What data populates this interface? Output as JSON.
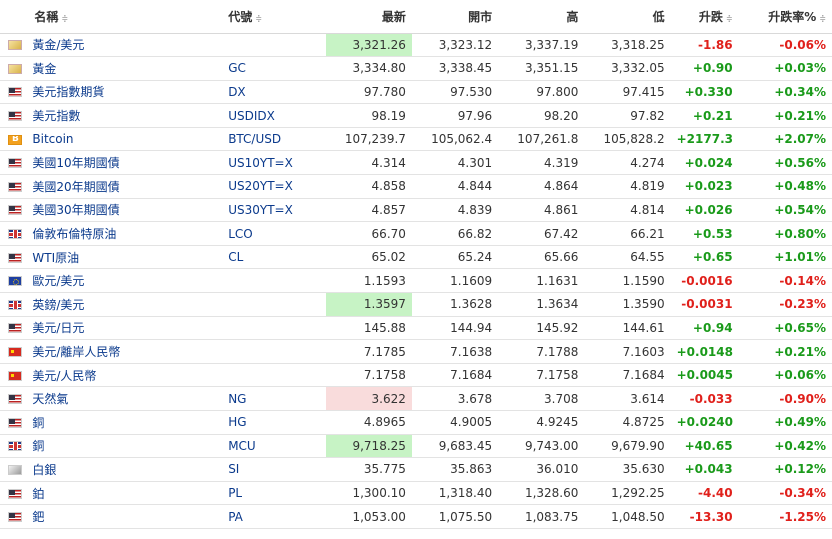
{
  "headers": {
    "name": "名稱",
    "symbol": "代號",
    "last": "最新",
    "open": "開市",
    "high": "高",
    "low": "低",
    "change": "升跌",
    "change_pct": "升跌率%",
    "sort_glyph": "≑"
  },
  "colors": {
    "up": "#1a9a1a",
    "down": "#e0201b",
    "highlight_green": "#c7f3c5",
    "highlight_red": "#f9dcdc",
    "link": "#0b3a8c"
  },
  "rows": [
    {
      "flag": "gold-icon",
      "name": "黃金/美元",
      "symbol": "",
      "last": "3,321.26",
      "open": "3,323.12",
      "high": "3,337.19",
      "low": "3,318.25",
      "change": "-1.86",
      "change_pct": "-0.06%",
      "dir": "down",
      "hl": "green"
    },
    {
      "flag": "gold-icon",
      "name": "黃金",
      "symbol": "GC",
      "last": "3,334.80",
      "open": "3,338.45",
      "high": "3,351.15",
      "low": "3,332.05",
      "change": "+0.90",
      "change_pct": "+0.03%",
      "dir": "up",
      "hl": ""
    },
    {
      "flag": "us-flag-icon",
      "name": "美元指數期貨",
      "symbol": "DX",
      "last": "97.780",
      "open": "97.530",
      "high": "97.800",
      "low": "97.415",
      "change": "+0.330",
      "change_pct": "+0.34%",
      "dir": "up",
      "hl": ""
    },
    {
      "flag": "us-flag-icon",
      "name": "美元指數",
      "symbol": "USDIDX",
      "last": "98.19",
      "open": "97.96",
      "high": "98.20",
      "low": "97.82",
      "change": "+0.21",
      "change_pct": "+0.21%",
      "dir": "up",
      "hl": ""
    },
    {
      "flag": "bitcoin-icon",
      "name": "Bitcoin",
      "symbol": "BTC/USD",
      "last": "107,239.7",
      "open": "105,062.4",
      "high": "107,261.8",
      "low": "105,828.2",
      "change": "+2177.3",
      "change_pct": "+2.07%",
      "dir": "up",
      "hl": ""
    },
    {
      "flag": "us-flag-icon",
      "name": "美國10年期國債",
      "symbol": "US10YT=X",
      "last": "4.314",
      "open": "4.301",
      "high": "4.319",
      "low": "4.274",
      "change": "+0.024",
      "change_pct": "+0.56%",
      "dir": "up",
      "hl": ""
    },
    {
      "flag": "us-flag-icon",
      "name": "美國20年期國債",
      "symbol": "US20YT=X",
      "last": "4.858",
      "open": "4.844",
      "high": "4.864",
      "low": "4.819",
      "change": "+0.023",
      "change_pct": "+0.48%",
      "dir": "up",
      "hl": ""
    },
    {
      "flag": "us-flag-icon",
      "name": "美國30年期國債",
      "symbol": "US30YT=X",
      "last": "4.857",
      "open": "4.839",
      "high": "4.861",
      "low": "4.814",
      "change": "+0.026",
      "change_pct": "+0.54%",
      "dir": "up",
      "hl": ""
    },
    {
      "flag": "uk-flag-icon",
      "name": "倫敦布倫特原油",
      "symbol": "LCO",
      "last": "66.70",
      "open": "66.82",
      "high": "67.42",
      "low": "66.21",
      "change": "+0.53",
      "change_pct": "+0.80%",
      "dir": "up",
      "hl": ""
    },
    {
      "flag": "us-flag-icon",
      "name": "WTI原油",
      "symbol": "CL",
      "last": "65.02",
      "open": "65.24",
      "high": "65.66",
      "low": "64.55",
      "change": "+0.65",
      "change_pct": "+1.01%",
      "dir": "up",
      "hl": ""
    },
    {
      "flag": "eu-flag-icon",
      "name": "歐元/美元",
      "symbol": "",
      "last": "1.1593",
      "open": "1.1609",
      "high": "1.1631",
      "low": "1.1590",
      "change": "-0.0016",
      "change_pct": "-0.14%",
      "dir": "down",
      "hl": ""
    },
    {
      "flag": "uk-flag-icon",
      "name": "英鎊/美元",
      "symbol": "",
      "last": "1.3597",
      "open": "1.3628",
      "high": "1.3634",
      "low": "1.3590",
      "change": "-0.0031",
      "change_pct": "-0.23%",
      "dir": "down",
      "hl": "green"
    },
    {
      "flag": "us-flag-icon",
      "name": "美元/日元",
      "symbol": "",
      "last": "145.88",
      "open": "144.94",
      "high": "145.92",
      "low": "144.61",
      "change": "+0.94",
      "change_pct": "+0.65%",
      "dir": "up",
      "hl": ""
    },
    {
      "flag": "cn-flag-icon",
      "name": "美元/離岸人民幣",
      "symbol": "",
      "last": "7.1785",
      "open": "7.1638",
      "high": "7.1788",
      "low": "7.1603",
      "change": "+0.0148",
      "change_pct": "+0.21%",
      "dir": "up",
      "hl": ""
    },
    {
      "flag": "cn-flag-icon",
      "name": "美元/人民幣",
      "symbol": "",
      "last": "7.1758",
      "open": "7.1684",
      "high": "7.1758",
      "low": "7.1684",
      "change": "+0.0045",
      "change_pct": "+0.06%",
      "dir": "up",
      "hl": ""
    },
    {
      "flag": "us-flag-icon",
      "name": "天然氣",
      "symbol": "NG",
      "last": "3.622",
      "open": "3.678",
      "high": "3.708",
      "low": "3.614",
      "change": "-0.033",
      "change_pct": "-0.90%",
      "dir": "down",
      "hl": "red"
    },
    {
      "flag": "us-flag-icon",
      "name": "銅",
      "symbol": "HG",
      "last": "4.8965",
      "open": "4.9005",
      "high": "4.9245",
      "low": "4.8725",
      "change": "+0.0240",
      "change_pct": "+0.49%",
      "dir": "up",
      "hl": ""
    },
    {
      "flag": "uk-flag-icon",
      "name": "銅",
      "symbol": "MCU",
      "last": "9,718.25",
      "open": "9,683.45",
      "high": "9,743.00",
      "low": "9,679.90",
      "change": "+40.65",
      "change_pct": "+0.42%",
      "dir": "up",
      "hl": "green"
    },
    {
      "flag": "silver-icon",
      "name": "白銀",
      "symbol": "SI",
      "last": "35.775",
      "open": "35.863",
      "high": "36.010",
      "low": "35.630",
      "change": "+0.043",
      "change_pct": "+0.12%",
      "dir": "up",
      "hl": ""
    },
    {
      "flag": "us-flag-icon",
      "name": "鉑",
      "symbol": "PL",
      "last": "1,300.10",
      "open": "1,318.40",
      "high": "1,328.60",
      "low": "1,292.25",
      "change": "-4.40",
      "change_pct": "-0.34%",
      "dir": "down",
      "hl": ""
    },
    {
      "flag": "us-flag-icon",
      "name": "鈀",
      "symbol": "PA",
      "last": "1,053.00",
      "open": "1,075.50",
      "high": "1,083.75",
      "low": "1,048.50",
      "change": "-13.30",
      "change_pct": "-1.25%",
      "dir": "down",
      "hl": ""
    }
  ]
}
